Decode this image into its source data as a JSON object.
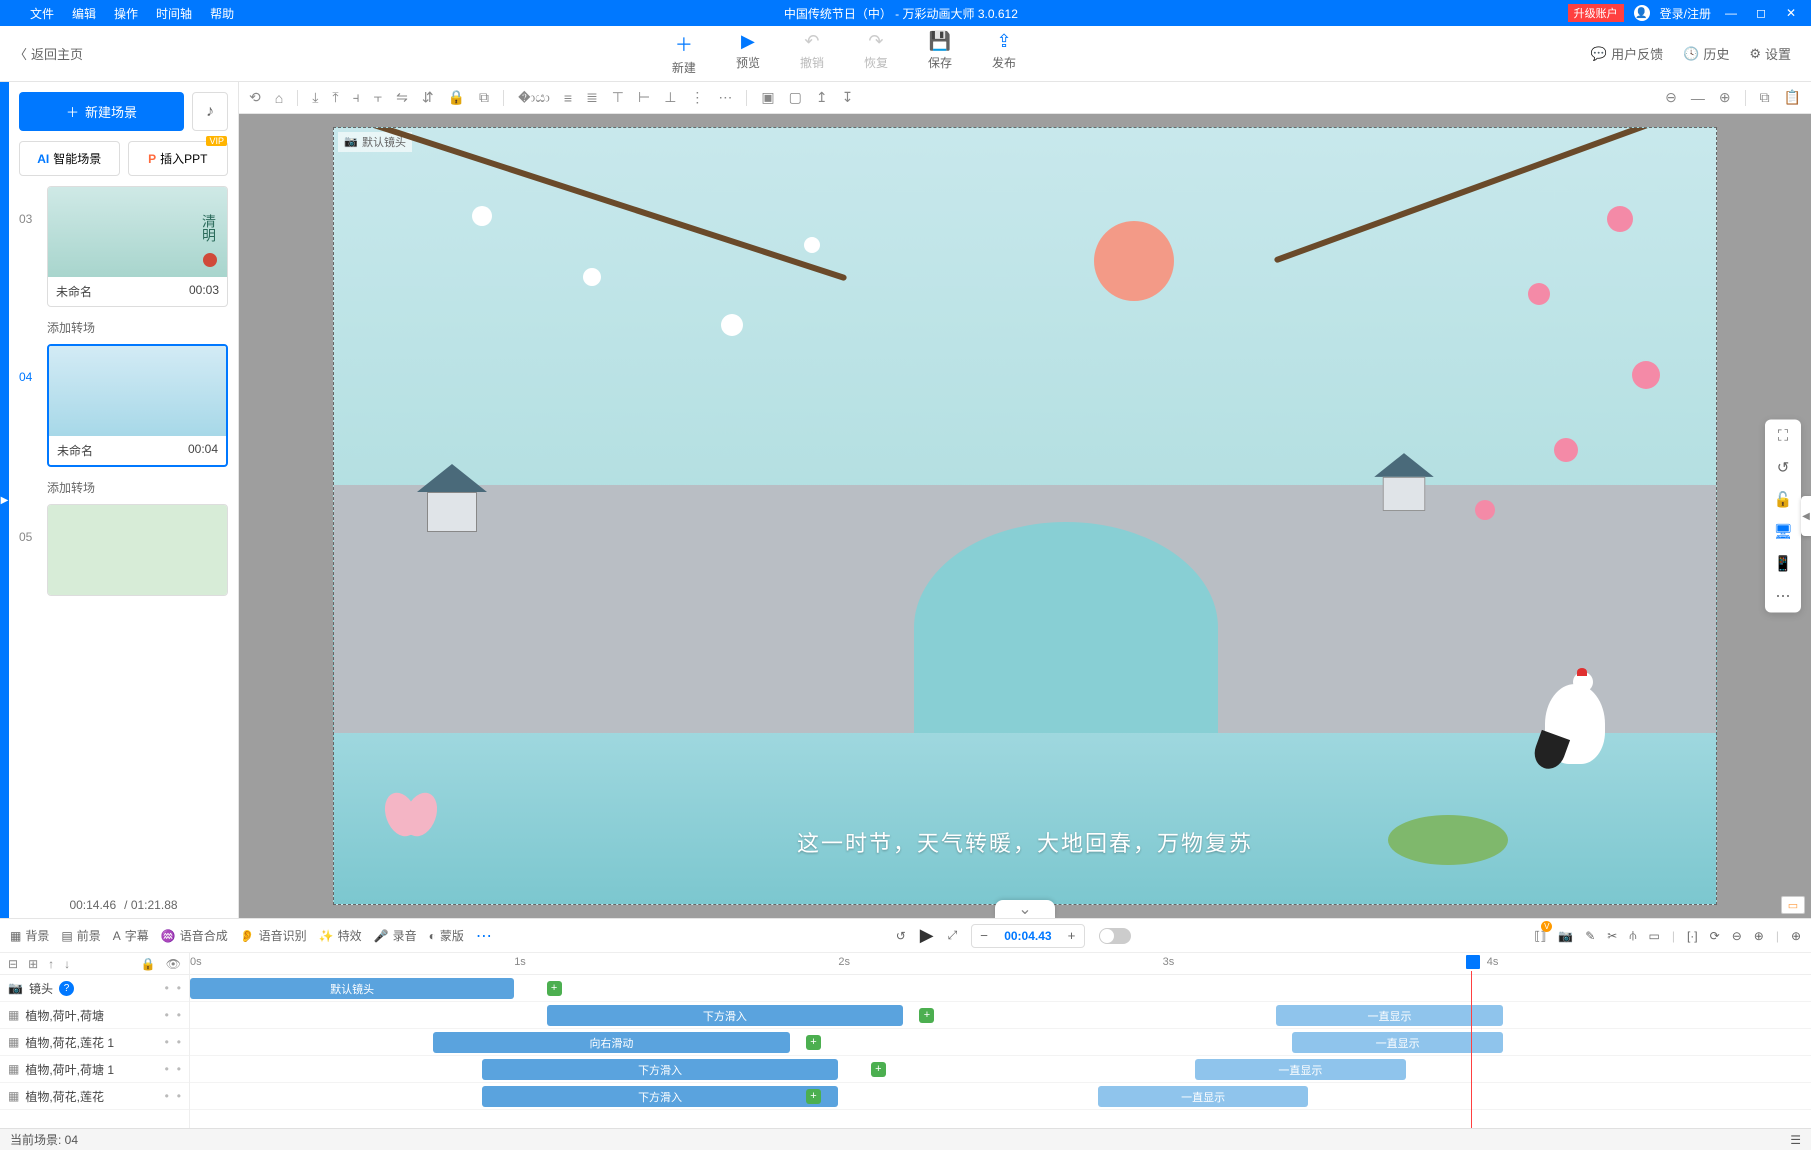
{
  "titlebar": {
    "menus": [
      "文件",
      "编辑",
      "操作",
      "时间轴",
      "帮助"
    ],
    "title": "中国传统节日（中）  - 万彩动画大师 3.0.612",
    "upgrade": "升级账户",
    "login": "登录/注册"
  },
  "toolbar": {
    "back": "返回主页",
    "buttons": [
      {
        "label": "新建",
        "icon": "＋",
        "disabled": false
      },
      {
        "label": "预览",
        "icon": "▶",
        "disabled": false
      },
      {
        "label": "撤销",
        "icon": "↶",
        "disabled": true
      },
      {
        "label": "恢复",
        "icon": "↷",
        "disabled": true
      },
      {
        "label": "保存",
        "icon": "💾",
        "disabled": false
      },
      {
        "label": "发布",
        "icon": "⇪",
        "disabled": false
      }
    ],
    "right": {
      "feedback": "用户反馈",
      "history": "历史",
      "settings": "设置"
    }
  },
  "scenePanel": {
    "newScene": "新建场景",
    "aiScene": "智能场景",
    "insertPpt": "插入PPT",
    "vip": "VIP",
    "addTransition": "添加转场",
    "scenes": [
      {
        "num": "03",
        "name": "未命名",
        "time": "00:03",
        "selected": false,
        "sideLabel": "清明"
      },
      {
        "num": "04",
        "name": "未命名",
        "time": "00:04",
        "selected": true
      },
      {
        "num": "05",
        "name": "",
        "time": "",
        "selected": false
      }
    ],
    "currentTime": "00:14.46",
    "totalTime": "/ 01:21.88"
  },
  "canvas": {
    "lensTag": "默认镜头",
    "subtitle": "这一时节，天气转暖，大地回春，万物复苏"
  },
  "timelineToolbar": {
    "items": [
      "背景",
      "前景",
      "字幕",
      "语音合成",
      "语音识别",
      "特效",
      "录音",
      "蒙版"
    ],
    "timecode": "00:04.43"
  },
  "ruler": [
    "0s",
    "1s",
    "2s",
    "3s",
    "4s"
  ],
  "tracks": {
    "camera": {
      "label": "镜头",
      "clip": "默认镜头"
    },
    "rows": [
      {
        "label": "植物,荷叶,荷塘",
        "in": "下方滑入",
        "stay": "一直显示",
        "inL": 22,
        "inW": 22,
        "plus": 45,
        "stayL": 67,
        "stayW": 14
      },
      {
        "label": "植物,荷花,莲花 1",
        "in": "向右滑动",
        "stay": "一直显示",
        "inL": 15,
        "inW": 22,
        "plus": 38,
        "stayL": 68,
        "stayW": 13
      },
      {
        "label": "植物,荷叶,荷塘 1",
        "in": "下方滑入",
        "stay": "一直显示",
        "inL": 18,
        "inW": 22,
        "plus": 42,
        "stayL": 62,
        "stayW": 13
      },
      {
        "label": "植物,荷花,莲花",
        "in": "下方滑入",
        "stay": "一直显示",
        "inL": 18,
        "inW": 22,
        "plus": 38,
        "stayL": 56,
        "stayW": 13
      }
    ]
  },
  "statusbar": {
    "currentScene": "当前场景: 04"
  }
}
